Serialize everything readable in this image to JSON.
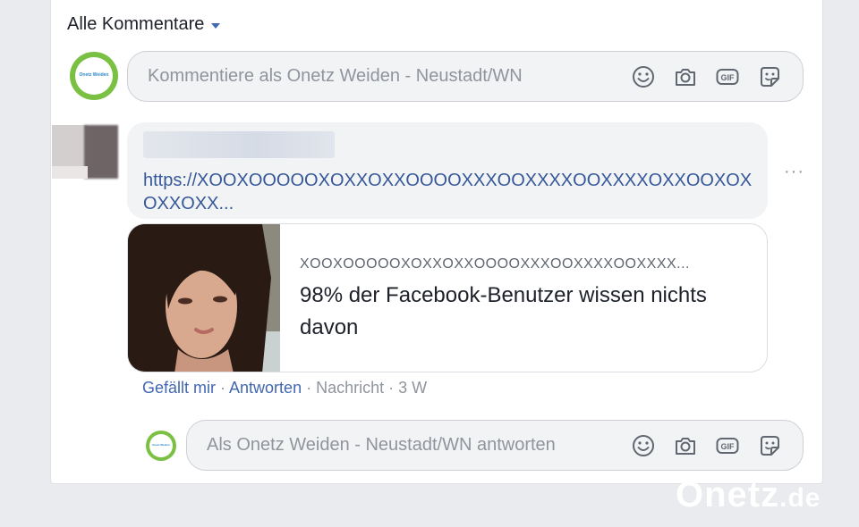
{
  "comments_filter": {
    "label": "Alle Kommentare"
  },
  "page": {
    "avatar_text": "Onetz Weiden",
    "colors": {
      "ring": "#7ac143",
      "text": "#2e87c8"
    }
  },
  "comment_composer": {
    "placeholder": "Kommentiere als Onetz Weiden - Neustadt/WN",
    "icons": [
      "emoji-icon",
      "camera-icon",
      "gif-icon",
      "sticker-icon"
    ]
  },
  "comment": {
    "link_text": "https://XOOXOOOOOXOXXOXXOOOOXXXOOXXXXOOXXXXOXXOOXOXOXXOXX...",
    "more_options": "···",
    "preview": {
      "domain": "XOOXOOOOOXOXXOXXOOOOXXXOOXXXXOOXXXX...",
      "title": "98% der Facebook-Benutzer wissen nichts davon"
    },
    "actions": {
      "like": "Gefällt mir",
      "sep1": " · ",
      "reply": "Antworten",
      "sep2": " · ",
      "message": "Nachricht",
      "sep3": " · ",
      "time": "3 W"
    }
  },
  "reply_composer": {
    "placeholder": "Als Onetz Weiden - Neustadt/WN antworten",
    "icons": [
      "emoji-icon",
      "camera-icon",
      "gif-icon",
      "sticker-icon"
    ]
  },
  "watermark": {
    "brand": "Onetz",
    "suffix": ".de"
  },
  "colors": {
    "link": "#365899",
    "accent": "#4267b2",
    "background": "#e9ebee"
  }
}
